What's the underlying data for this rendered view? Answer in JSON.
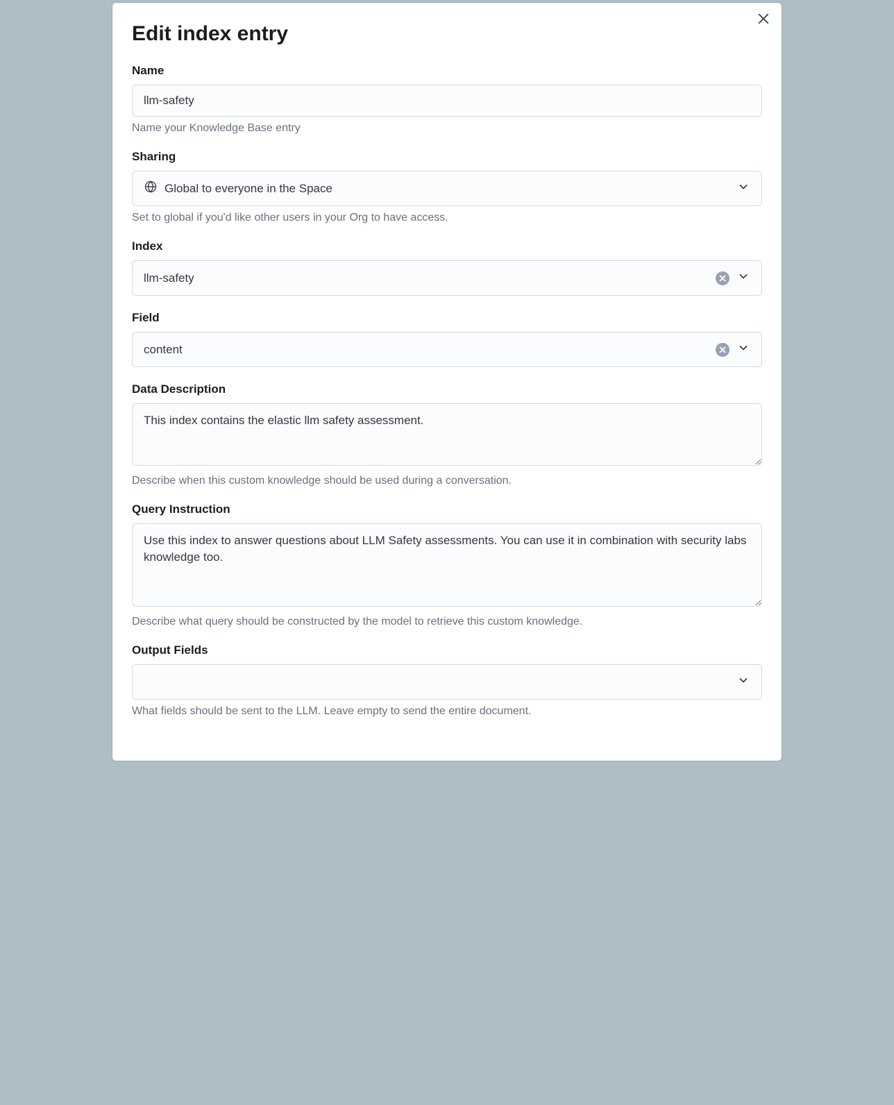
{
  "title": "Edit index entry",
  "fields": {
    "name": {
      "label": "Name",
      "value": "llm-safety",
      "help": "Name your Knowledge Base entry"
    },
    "sharing": {
      "label": "Sharing",
      "value": "Global to everyone in the Space",
      "help": "Set to global if you'd like other users in your Org to have access."
    },
    "index": {
      "label": "Index",
      "value": "llm-safety"
    },
    "field": {
      "label": "Field",
      "value": "content"
    },
    "data_description": {
      "label": "Data Description",
      "value": "This index contains the elastic llm safety assessment.",
      "help": "Describe when this custom knowledge should be used during a conversation."
    },
    "query_instruction": {
      "label": "Query Instruction",
      "value": "Use this index to answer questions about LLM Safety assessments. You can use it in combination with security labs knowledge too.",
      "help": "Describe what query should be constructed by the model to retrieve this custom knowledge."
    },
    "output_fields": {
      "label": "Output Fields",
      "value": "",
      "help": "What fields should be sent to the LLM. Leave empty to send the entire document."
    }
  }
}
